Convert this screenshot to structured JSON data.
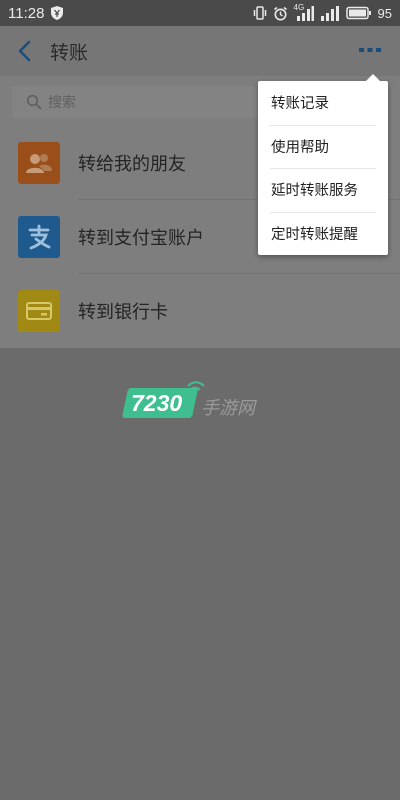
{
  "status_bar": {
    "time": "11:28",
    "network": "4G",
    "battery": "95"
  },
  "header": {
    "title": "转账"
  },
  "search": {
    "placeholder": "搜索"
  },
  "list": [
    {
      "label": "转给我的朋友",
      "icon": "contacts-icon",
      "color": "#9a4f1a"
    },
    {
      "label": "转到支付宝账户",
      "icon": "alipay-icon",
      "color": "#1f5a8f"
    },
    {
      "label": "转到银行卡",
      "icon": "bank-card-icon",
      "color": "#a08a14"
    }
  ],
  "menu": {
    "items": [
      "转账记录",
      "使用帮助",
      "延时转账服务",
      "定时转账提醒"
    ]
  },
  "watermark": {
    "number": "7230",
    "text": "手游网"
  },
  "colors": {
    "accent": "#1e6fb0"
  }
}
